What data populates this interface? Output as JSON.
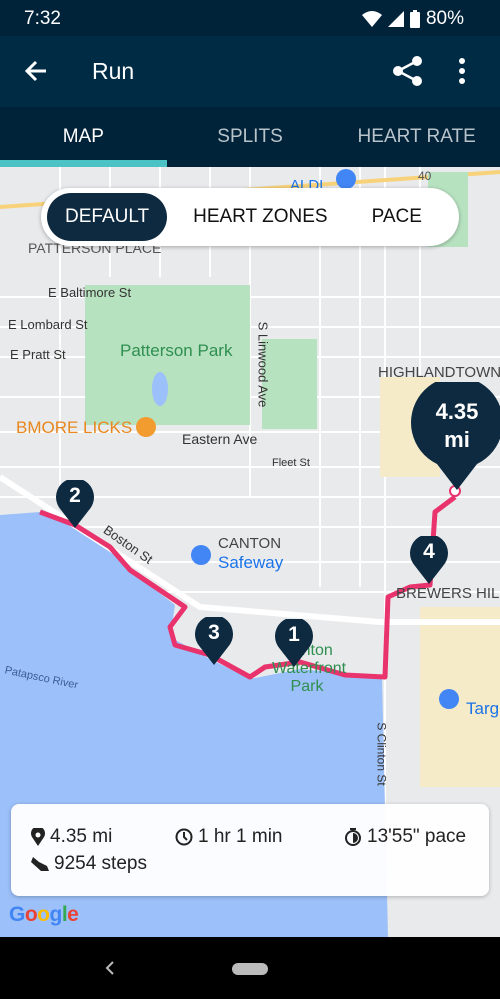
{
  "status_bar": {
    "time": "7:32",
    "battery": "80%"
  },
  "app_bar": {
    "title": "Run",
    "back_icon": "arrow-left-icon",
    "share_icon": "share-icon",
    "more_icon": "more-vert-icon"
  },
  "tabs": [
    {
      "label": "MAP",
      "active": true
    },
    {
      "label": "SPLITS",
      "active": false
    },
    {
      "label": "HEART RATE",
      "active": false
    }
  ],
  "map_modes": [
    {
      "label": "DEFAULT",
      "active": true
    },
    {
      "label": "HEART ZONES",
      "active": false
    },
    {
      "label": "PACE",
      "active": false
    }
  ],
  "map": {
    "labels": {
      "aldi": "ALDI",
      "patterson_place": "PATTERSON PLACE",
      "baltimore_st": "E Baltimore St",
      "lombard_st": "E Lombard St",
      "pratt_st": "E Pratt St",
      "patterson_park": "Patterson Park",
      "linwood": "S Linwood Ave",
      "highlandtown": "HIGHLANDTOWN",
      "bmore_licks": "BMORE LICKS",
      "eastern_ave": "Eastern Ave",
      "fleet_st": "Fleet St",
      "boston_st": "Boston St",
      "canton": "CANTON",
      "safeway": "Safeway",
      "brewers_hill": "BREWERS HILL",
      "canton_waterfront": "Canton Waterfront Park",
      "patapsco": "Patapsco River",
      "clinton": "S Clinton St",
      "target": "Targ",
      "route_40": "40"
    },
    "markers": [
      "1",
      "2",
      "3",
      "4"
    ],
    "distance_marker": {
      "value": "4.35",
      "unit": "mi"
    },
    "route_color": "#e8336d",
    "water_color": "#9cc0f9",
    "park_color": "#b7e2c0"
  },
  "summary": {
    "distance": "4.35 mi",
    "duration": "1 hr 1 min",
    "pace": "13'55\" pace",
    "steps": "9254 steps"
  },
  "google_logo": "Google",
  "colors": {
    "accent": "#4bc3c4",
    "app_bar": "#002b45"
  }
}
